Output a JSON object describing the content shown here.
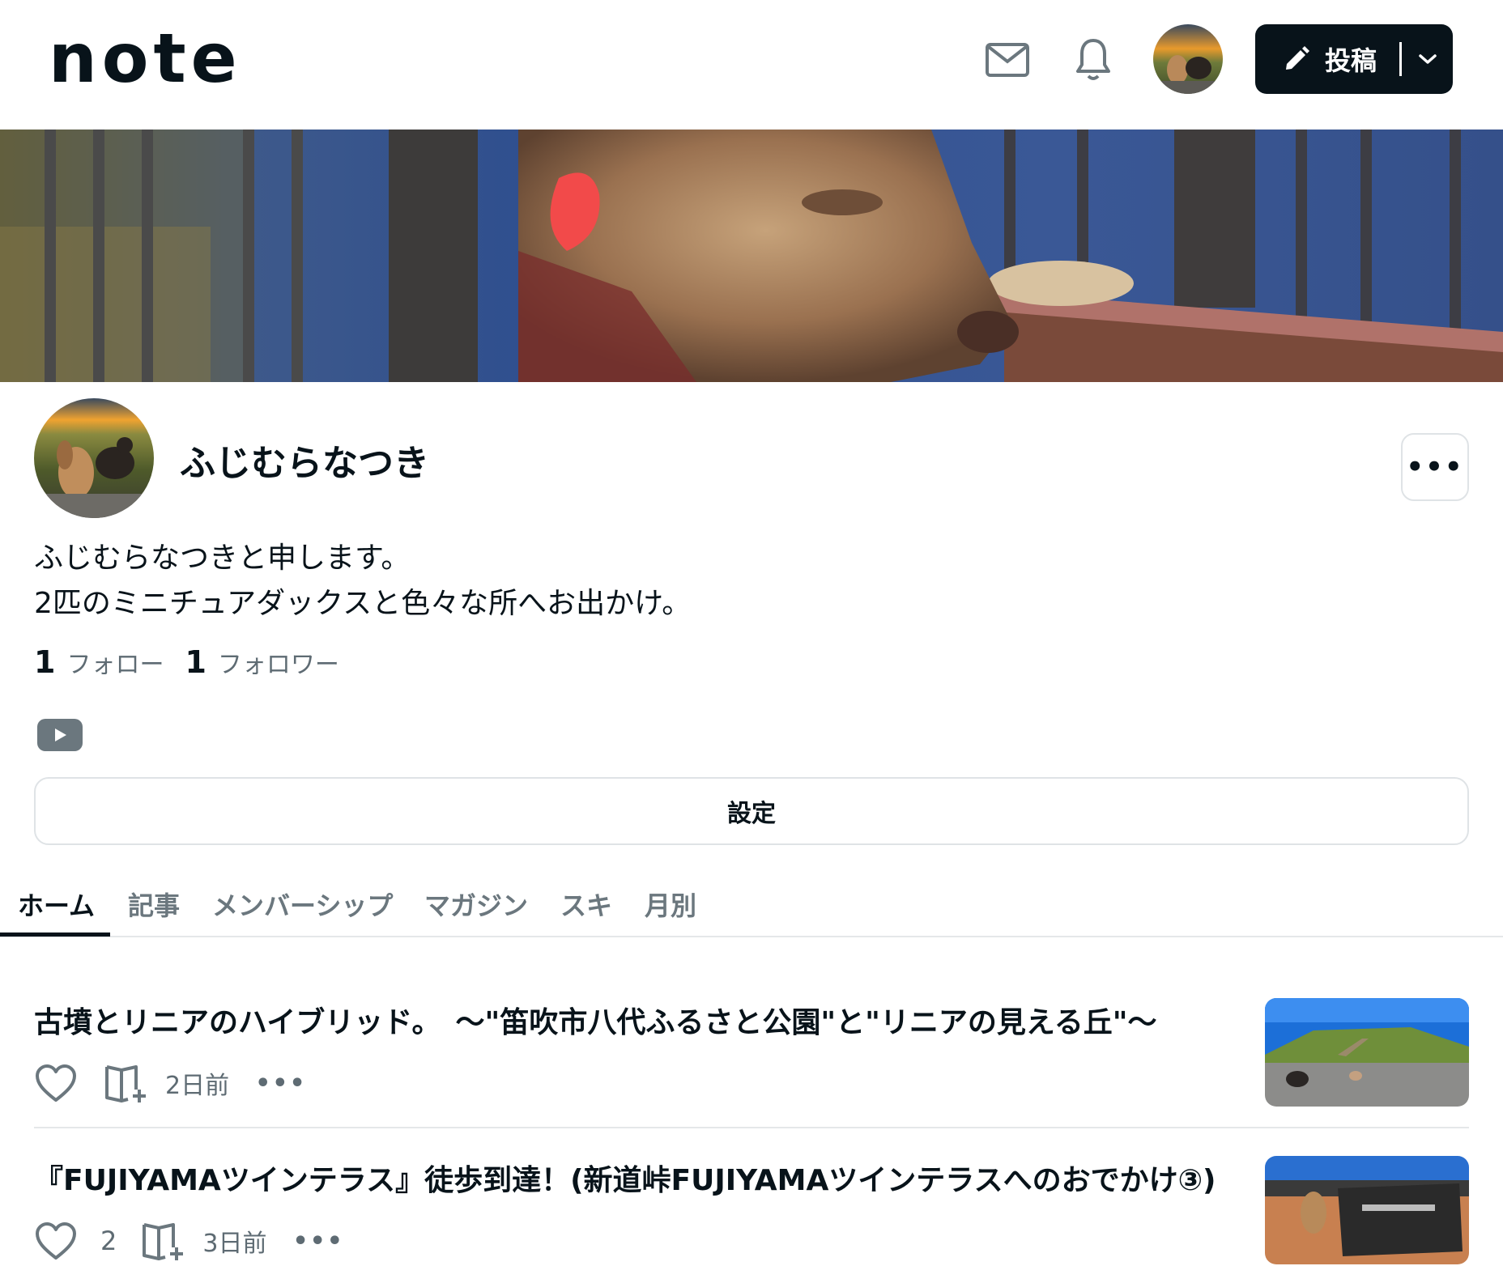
{
  "header": {
    "logo": "note",
    "post_button_label": "投稿"
  },
  "profile": {
    "name": "ふじむらなつき",
    "more_label": "•••",
    "bio_lines": [
      "ふじむらなつきと申します。",
      "2匹のミニチュアダックスと色々な所へお出かけ。"
    ],
    "following_count": "1",
    "following_label": "フォロー",
    "followers_count": "1",
    "followers_label": "フォロワー",
    "settings_label": "設定"
  },
  "tabs": [
    {
      "label": "ホーム",
      "active": true
    },
    {
      "label": "記事"
    },
    {
      "label": "メンバーシップ"
    },
    {
      "label": "マガジン"
    },
    {
      "label": "スキ"
    },
    {
      "label": "月別"
    }
  ],
  "articles": [
    {
      "title": "古墳とリニアのハイブリッド。　〜\"笛吹市八代ふるさと公園\"と\"リニアの見える丘\"〜",
      "likes": "",
      "time": "2日前",
      "more_label": "•••"
    },
    {
      "title": "『FUJIYAMAツインテラス』徒歩到達！(新道峠FUJIYAMAツインテラスへのおでかけ③)",
      "likes": "2",
      "time": "3日前",
      "more_label": "•••"
    }
  ],
  "colors": {
    "text": "#08131a",
    "muted": "#5e6b73",
    "border": "#dfe3e6",
    "post_button_bg": "#08131a"
  }
}
